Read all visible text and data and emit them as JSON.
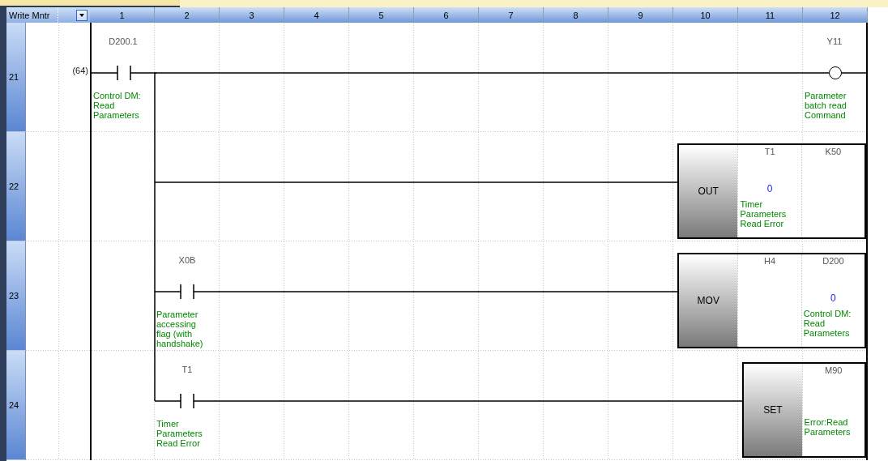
{
  "header": {
    "mode_label": "Write Mntr",
    "columns": [
      "1",
      "2",
      "3",
      "4",
      "5",
      "6",
      "7",
      "8",
      "9",
      "10",
      "11",
      "12"
    ]
  },
  "rungs": [
    {
      "number": "21",
      "step": "(64)",
      "cells": [
        {
          "kind": "contact",
          "branch": false,
          "device": "D200.1",
          "comment": "Control DM: Read Parameters"
        },
        {
          "kind": "wire",
          "branch": false
        },
        {
          "kind": "wire",
          "branch": false
        },
        {
          "kind": "wire",
          "branch": false
        },
        {
          "kind": "wire",
          "branch": false
        },
        {
          "kind": "wire",
          "branch": false
        },
        {
          "kind": "wire",
          "branch": false
        },
        {
          "kind": "wire",
          "branch": false
        },
        {
          "kind": "wire",
          "branch": false
        },
        {
          "kind": "wire",
          "branch": false
        },
        {
          "kind": "wire",
          "branch": false
        },
        {
          "kind": "coil",
          "branch": false,
          "device": "Y11",
          "comment": "Parameter batch read Command"
        }
      ]
    },
    {
      "number": "22",
      "cells": [
        {
          "kind": "blank",
          "branch": false
        },
        {
          "kind": "wire",
          "branch": true
        },
        {
          "kind": "wire",
          "branch": false
        },
        {
          "kind": "wire",
          "branch": false
        },
        {
          "kind": "wire",
          "branch": false
        },
        {
          "kind": "wire",
          "branch": false
        },
        {
          "kind": "wire",
          "branch": false
        },
        {
          "kind": "wire",
          "branch": false
        },
        {
          "kind": "wire",
          "branch": false
        },
        {
          "kind": "instruction",
          "branch": false,
          "mnemonic": "OUT",
          "operands": [
            {
              "device": "T1",
              "value": "0",
              "comment": "Timer Parameters Read Error"
            },
            {
              "device": "K50"
            }
          ]
        }
      ]
    },
    {
      "number": "23",
      "cells": [
        {
          "kind": "blank",
          "branch": false
        },
        {
          "kind": "contact",
          "branch": true,
          "device": "X0B",
          "comment": "Parameter accessing flag (with handshake)"
        },
        {
          "kind": "wire",
          "branch": false
        },
        {
          "kind": "wire",
          "branch": false
        },
        {
          "kind": "wire",
          "branch": false
        },
        {
          "kind": "wire",
          "branch": false
        },
        {
          "kind": "wire",
          "branch": false
        },
        {
          "kind": "wire",
          "branch": false
        },
        {
          "kind": "wire",
          "branch": false
        },
        {
          "kind": "instruction",
          "branch": false,
          "mnemonic": "MOV",
          "operands": [
            {
              "device": "H4"
            },
            {
              "device": "D200",
              "value": "0",
              "comment": "Control DM: Read Parameters"
            }
          ]
        }
      ]
    },
    {
      "number": "24",
      "cells": [
        {
          "kind": "blank",
          "branch": false
        },
        {
          "kind": "contact",
          "branch": true,
          "device": "T1",
          "comment": "Timer Parameters Read Error"
        },
        {
          "kind": "wire",
          "branch": false
        },
        {
          "kind": "wire",
          "branch": false
        },
        {
          "kind": "wire",
          "branch": false
        },
        {
          "kind": "wire",
          "branch": false
        },
        {
          "kind": "wire",
          "branch": false
        },
        {
          "kind": "wire",
          "branch": false
        },
        {
          "kind": "wire",
          "branch": false
        },
        {
          "kind": "wire",
          "branch": false
        },
        {
          "kind": "instruction",
          "branch": false,
          "mnemonic": "SET",
          "operands": [
            {
              "device": "M90",
              "comment": "Error:Read Parameters"
            }
          ]
        }
      ]
    }
  ]
}
